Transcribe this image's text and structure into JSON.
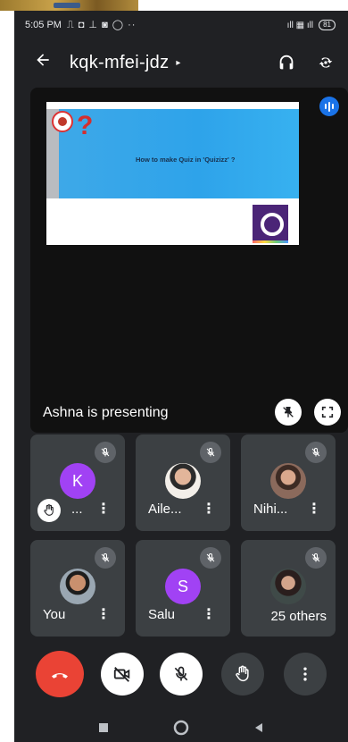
{
  "status_bar": {
    "time": "5:05 PM",
    "notification_icons": "⎍ ◘ ⊥ ◙ ◯ ··",
    "signal_icons": "ıll ▦ ıll",
    "battery": "81"
  },
  "app_bar": {
    "meeting_code": "kqk-mfei-jdz",
    "caret": "▸"
  },
  "presentation": {
    "slide_heading": "How to make Quiz in 'Quizizz' ?",
    "presenter_label": "Ashna is presenting"
  },
  "participants": [
    {
      "name": "...",
      "initial": "K",
      "avatar_color": "#a142f4",
      "hand_raised": true,
      "muted": true
    },
    {
      "name": "Aile...",
      "initial": "",
      "avatar_color": "",
      "muted": true
    },
    {
      "name": "Nihi...",
      "initial": "",
      "avatar_color": "",
      "muted": true
    },
    {
      "name": "You",
      "initial": "",
      "avatar_color": "",
      "muted": true
    },
    {
      "name": "Salu",
      "initial": "S",
      "avatar_color": "#a142f4",
      "muted": true
    },
    {
      "name": "25 others",
      "initial": "",
      "avatar_color": "",
      "muted": true
    }
  ],
  "colors": {
    "background": "#202124",
    "tile": "#3c4043",
    "end_call": "#ea4335",
    "accent_blue": "#1a73e8"
  },
  "icons": [
    "back-arrow-icon",
    "headphones-icon",
    "switch-camera-icon",
    "audio-level-icon",
    "pin-off-icon",
    "fullscreen-icon",
    "mic-off-icon",
    "raised-hand-icon",
    "end-call-icon",
    "camera-off-icon",
    "more-vert-icon",
    "nav-square-icon",
    "nav-circle-icon",
    "nav-back-triangle-icon"
  ]
}
